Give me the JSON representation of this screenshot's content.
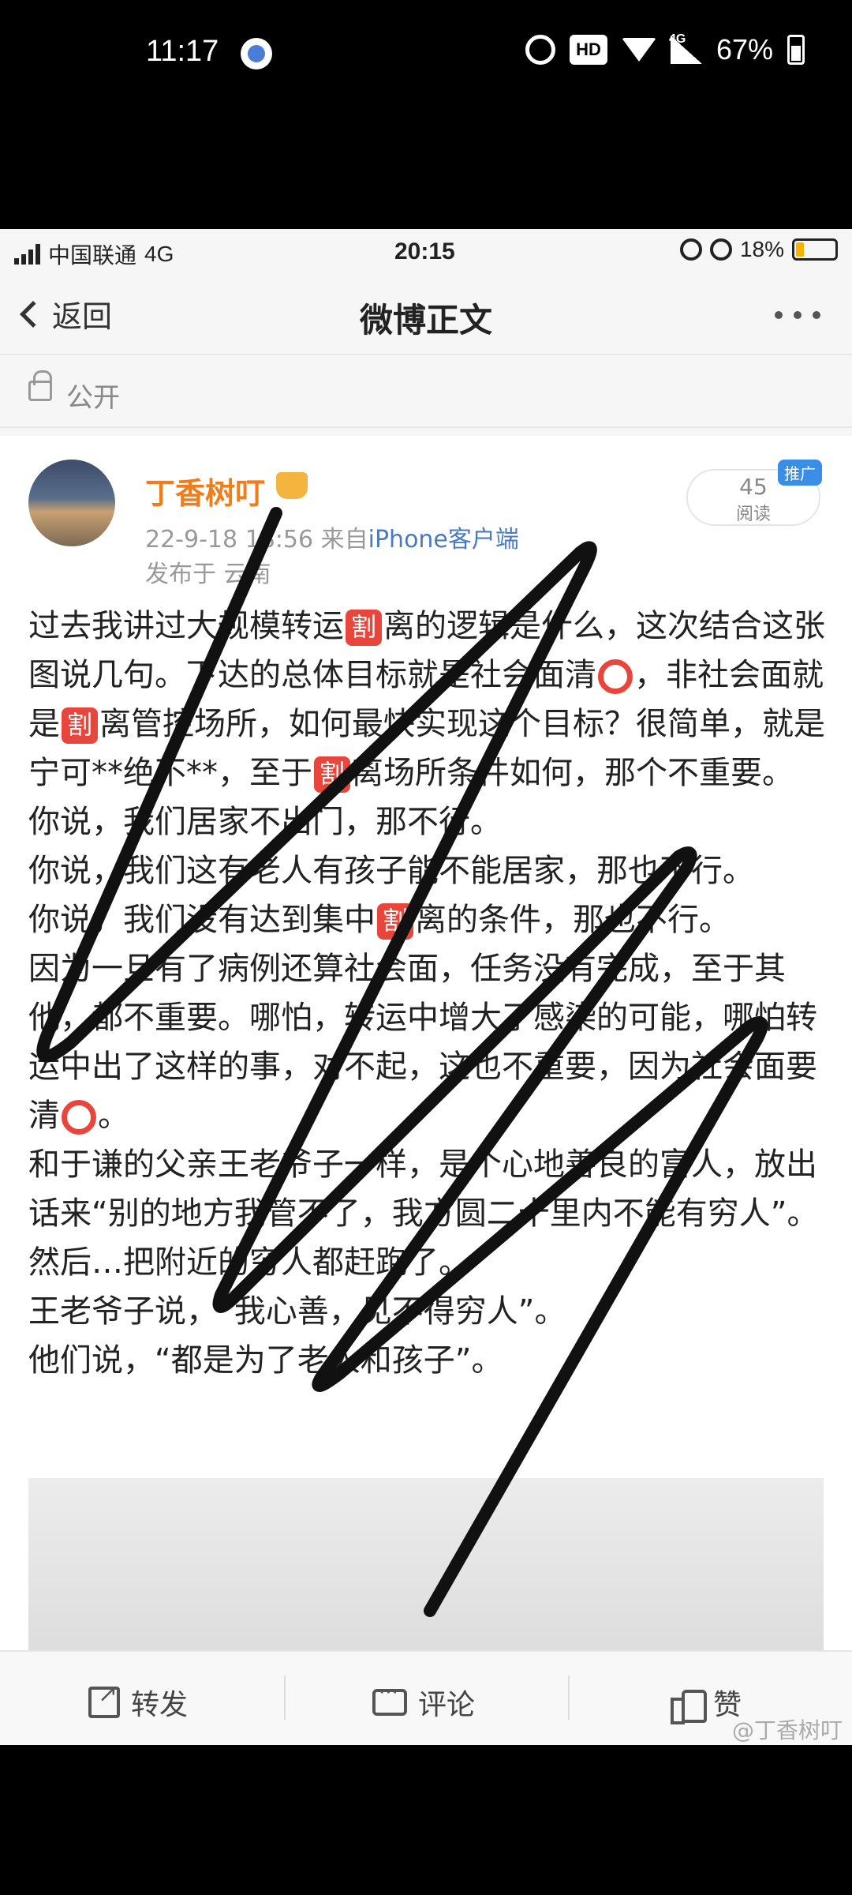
{
  "outer_status": {
    "time": "11:17",
    "hd": "HD",
    "signal_label": "4G",
    "battery": "67%"
  },
  "inner_status": {
    "carrier": "中国联通",
    "network": "4G",
    "time": "20:15",
    "battery": "18%"
  },
  "nav": {
    "back_label": "返回",
    "title": "微博正文"
  },
  "visibility": "公开",
  "post": {
    "author": "丁香树叮",
    "datetime": "22-9-18 18:56",
    "source_prefix": "来自",
    "source": "iPhone客户端",
    "location": "发布于 云南",
    "reads_count": "45",
    "reads_label": "阅读",
    "promo_badge": "推广",
    "seg1a": "过去我讲过大规模转运",
    "seg1b": "离的逻辑是什么，这次结合这张图说几句。下达的总体目标就是社会面清",
    "seg1c": "，非社会面就是",
    "seg1d": "离管控场所，如何最快实现这个目标？很简单，就是宁可**绝不**，至于",
    "seg1e": "离场所条件如何，那个不重要。",
    "p2": "你说，我们居家不出门，那不行。",
    "p3": "你说，我们这有老人有孩子能不能居家，那也不行。",
    "p4a": "你说，我们没有达到集中",
    "p4b": "离的条件，那也不行。",
    "p5a": "因为一旦有了病例还算社会面，任务没有完成，至于其他，都不重要。哪怕，转运中增大了感染的可能，哪怕转运中出了这样的事，对不起，这也不重要，因为社会面要清",
    "p5b": "。",
    "p6": "和于谦的父亲王老爷子一样，是个心地善良的富人，放出话来“别的地方我管不了，我方圆二十里内不能有穷人”。然后…把附近的穷人都赶跑了。",
    "p7": "王老爷子说，“我心善，见不得穷人”。",
    "p8": "他们说，“都是为了老人和孩子”。",
    "tag_char": "割"
  },
  "actions": {
    "forward": "转发",
    "comment": "评论",
    "like": "赞"
  },
  "watermark": "@丁香树叮",
  "colors": {
    "author": "#f07c1a",
    "tag": "#e8463c",
    "source": "#4a7bc0",
    "promo": "#3a8ee6"
  }
}
